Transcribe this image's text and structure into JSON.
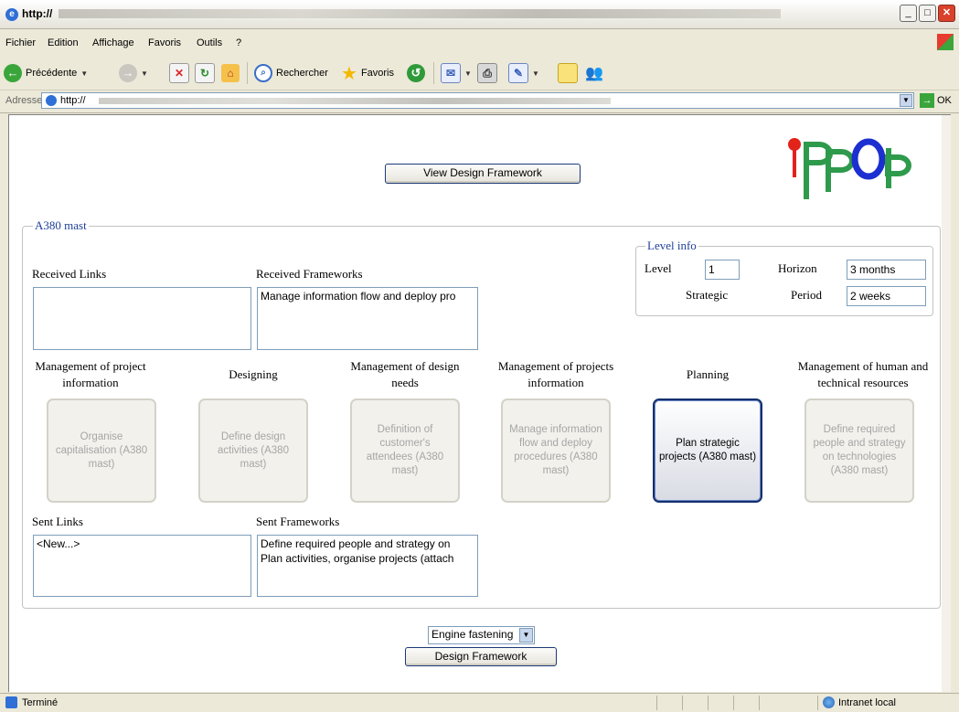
{
  "window": {
    "title": "http://"
  },
  "menu": {
    "items": [
      "Fichier",
      "Edition",
      "Affichage",
      "Favoris",
      "Outils",
      "?"
    ]
  },
  "toolbar": {
    "back_label": "Précédente",
    "search_label": "Rechercher",
    "favorites_label": "Favoris"
  },
  "address": {
    "label": "Adresse",
    "url": "http://",
    "go_label": "OK"
  },
  "page": {
    "view_button": "View Design Framework",
    "group_title": "A380 mast",
    "received_links_label": "Received Links",
    "received_links": [],
    "received_frameworks_label": "Received Frameworks",
    "received_frameworks": [
      "Manage information flow and deploy pro"
    ],
    "level_info": {
      "title": "Level info",
      "level_label": "Level",
      "level_value": "1",
      "horizon_label": "Horizon",
      "horizon_value": "3 months",
      "strategic_label": "Strategic",
      "period_label": "Period",
      "period_value": "2 weeks"
    },
    "cards": [
      {
        "title": "Management of project information",
        "text": "Organise capitalisation (A380 mast)",
        "active": false
      },
      {
        "title": "Designing",
        "text": "Define design activities (A380 mast)",
        "active": false
      },
      {
        "title": "Management of design needs",
        "text": "Definition of customer's attendees (A380 mast)",
        "active": false
      },
      {
        "title": "Management of projects information",
        "text": "Manage information flow and deploy procedures (A380 mast)",
        "active": false
      },
      {
        "title": "Planning",
        "text": "Plan strategic projects (A380 mast)",
        "active": true
      },
      {
        "title": "Management of human and technical resources",
        "text": "Define required people and strategy on technologies (A380 mast)",
        "active": false
      }
    ],
    "sent_links_label": "Sent Links",
    "sent_links": [
      "<New...>"
    ],
    "sent_frameworks_label": "Sent Frameworks",
    "sent_frameworks": [
      "Define required people and strategy on",
      "Plan activities, organise projects (attach"
    ],
    "select_value": "Engine fastening",
    "design_button": "Design Framework"
  },
  "status": {
    "text": "Terminé",
    "zone": "Intranet local"
  },
  "colors": {
    "accent": "#1f3f9a",
    "active_border": "#14306e",
    "logo_green": "#2e9a4b",
    "logo_blue": "#1c2fd0",
    "logo_red": "#e2231a"
  }
}
